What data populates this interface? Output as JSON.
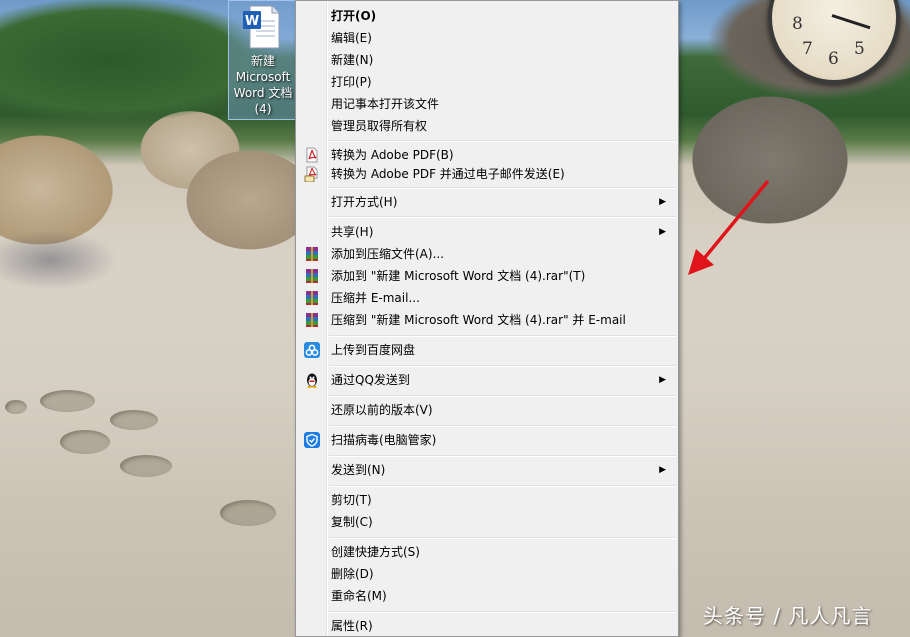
{
  "desktop": {
    "icon_label": "新建\nMicrosoft\nWord 文档\n(4)",
    "clock": [
      "8",
      "7",
      "6",
      "5"
    ],
    "watermark": "头条号 / 凡人凡言"
  },
  "menu": {
    "items": [
      {
        "label": "打开(O)",
        "icon": "",
        "submenu": false
      },
      {
        "label": "编辑(E)",
        "icon": "",
        "submenu": false
      },
      {
        "label": "新建(N)",
        "icon": "",
        "submenu": false
      },
      {
        "label": "打印(P)",
        "icon": "",
        "submenu": false
      },
      {
        "label": "用记事本打开该文件",
        "icon": "",
        "submenu": false
      },
      {
        "label": "管理员取得所有权",
        "icon": "",
        "submenu": false
      },
      {
        "label": "转换为 Adobe PDF(B)",
        "icon": "adobe-pdf-icon",
        "submenu": false
      },
      {
        "label": "转换为 Adobe PDF 并通过电子邮件发送(E)",
        "icon": "adobe-pdf-email-icon",
        "submenu": false
      },
      {
        "label": "打开方式(H)",
        "icon": "",
        "submenu": true
      },
      {
        "label": "共享(H)",
        "icon": "",
        "submenu": true
      },
      {
        "label": "添加到压缩文件(A)...",
        "icon": "winrar-icon",
        "submenu": false
      },
      {
        "label": "添加到 \"新建 Microsoft Word 文档 (4).rar\"(T)",
        "icon": "winrar-icon",
        "submenu": false
      },
      {
        "label": "压缩并 E-mail...",
        "icon": "winrar-icon",
        "submenu": false
      },
      {
        "label": "压缩到 \"新建 Microsoft Word 文档 (4).rar\" 并 E-mail",
        "icon": "winrar-icon",
        "submenu": false
      },
      {
        "label": "上传到百度网盘",
        "icon": "baidu-netdisk-icon",
        "submenu": false
      },
      {
        "label": "通过QQ发送到",
        "icon": "qq-penguin-icon",
        "submenu": true
      },
      {
        "label": "还原以前的版本(V)",
        "icon": "",
        "submenu": false
      },
      {
        "label": "扫描病毒(电脑管家)",
        "icon": "tencent-shield-icon",
        "submenu": false
      },
      {
        "label": "发送到(N)",
        "icon": "",
        "submenu": true
      },
      {
        "label": "剪切(T)",
        "icon": "",
        "submenu": false
      },
      {
        "label": "复制(C)",
        "icon": "",
        "submenu": false
      },
      {
        "label": "创建快捷方式(S)",
        "icon": "",
        "submenu": false
      },
      {
        "label": "删除(D)",
        "icon": "",
        "submenu": false
      },
      {
        "label": "重命名(M)",
        "icon": "",
        "submenu": false
      },
      {
        "label": "属性(R)",
        "icon": "",
        "submenu": false
      }
    ],
    "submenu_glyph": "▶"
  }
}
